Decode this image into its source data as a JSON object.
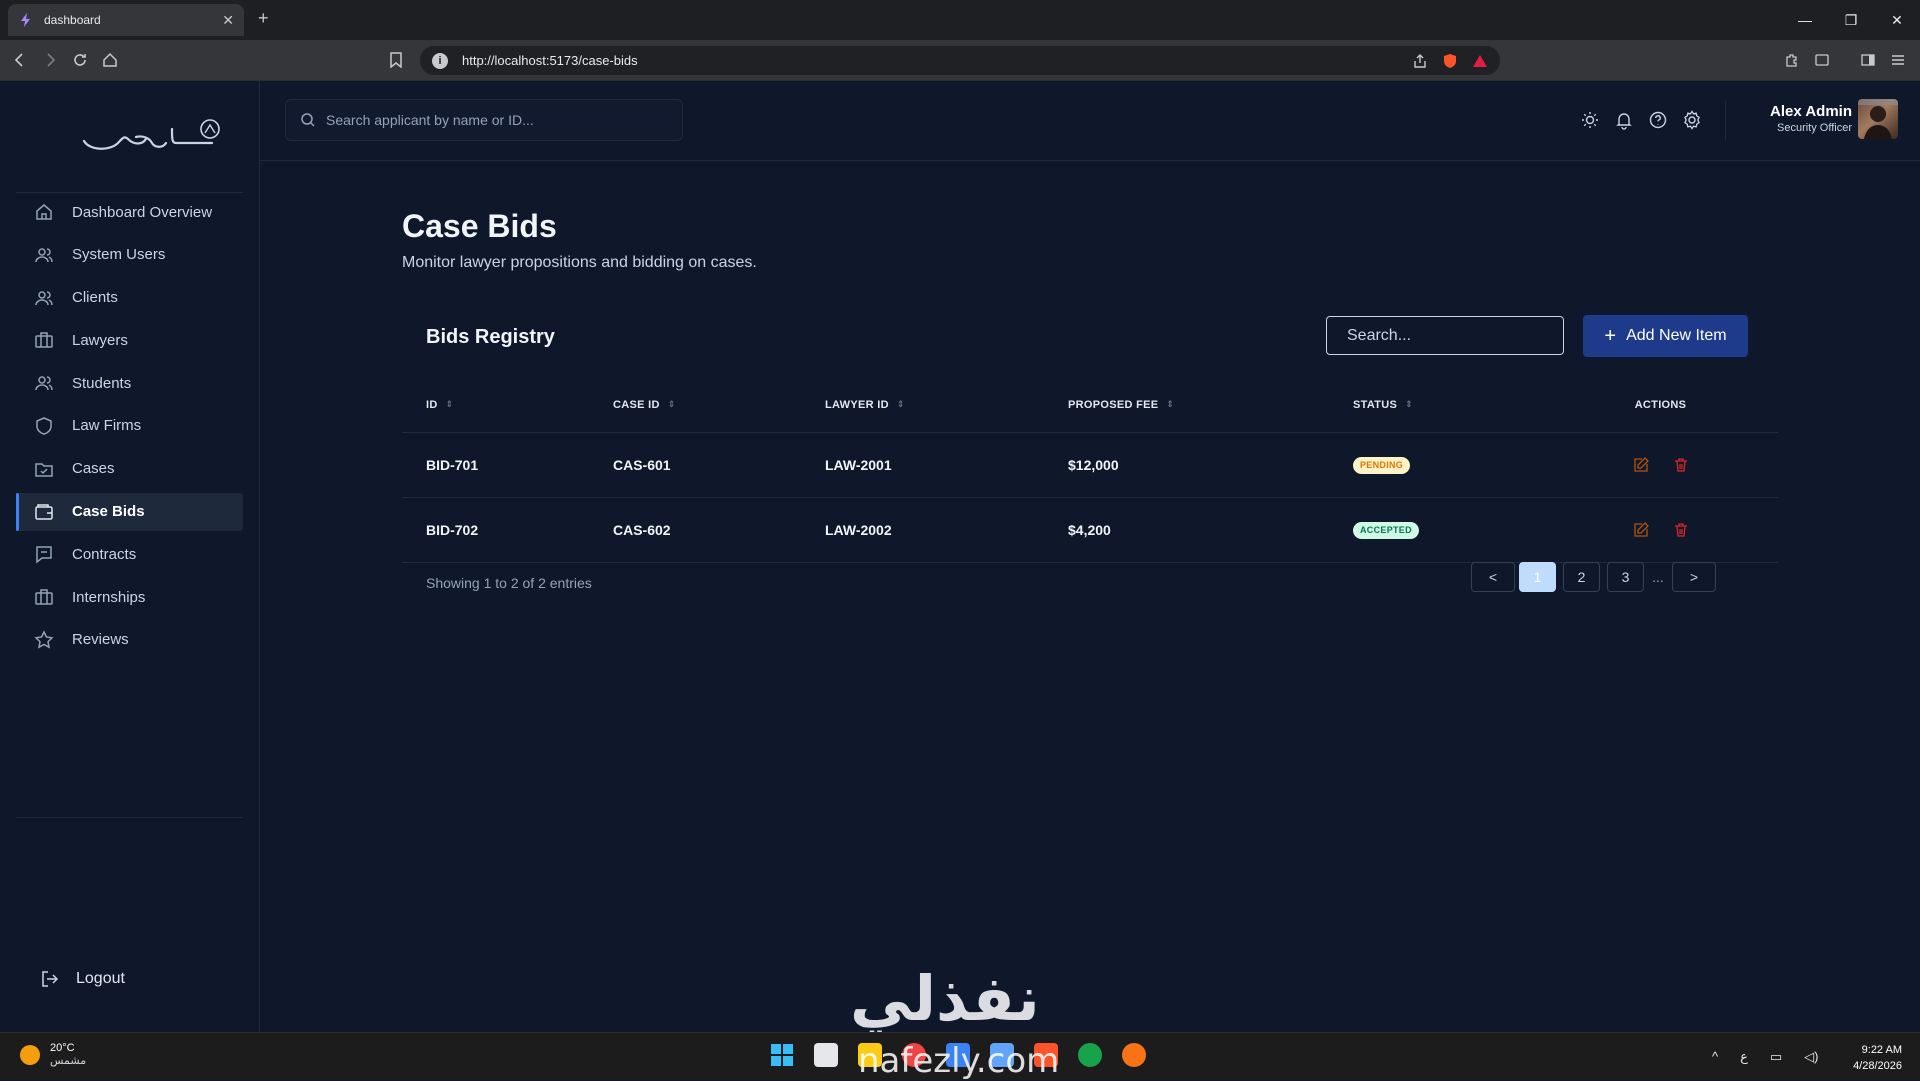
{
  "browser": {
    "tab_title": "dashboard",
    "url": "http://localhost:5173/case-bids"
  },
  "sidebar": {
    "items": [
      {
        "label": "Dashboard Overview",
        "icon": "home-icon"
      },
      {
        "label": "System Users",
        "icon": "users-icon"
      },
      {
        "label": "Clients",
        "icon": "users-icon"
      },
      {
        "label": "Lawyers",
        "icon": "briefcase-icon"
      },
      {
        "label": "Students",
        "icon": "users-icon"
      },
      {
        "label": "Law Firms",
        "icon": "shield-icon"
      },
      {
        "label": "Cases",
        "icon": "folder-icon"
      },
      {
        "label": "Case Bids",
        "icon": "wallet-icon",
        "active": true
      },
      {
        "label": "Contracts",
        "icon": "message-icon"
      },
      {
        "label": "Internships",
        "icon": "briefcase-icon"
      },
      {
        "label": "Reviews",
        "icon": "star-icon"
      }
    ],
    "logout_label": "Logout"
  },
  "header": {
    "search_placeholder": "Search applicant by name or ID...",
    "user_name": "Alex Admin",
    "user_role": "Security Officer"
  },
  "page": {
    "title": "Case Bids",
    "subtitle": "Monitor lawyer propositions and bidding on cases."
  },
  "registry": {
    "title": "Bids Registry",
    "search_placeholder": "Search...",
    "add_label": "Add New Item",
    "columns": [
      "ID",
      "CASE ID",
      "LAWYER ID",
      "PROPOSED FEE",
      "STATUS",
      "ACTIONS"
    ],
    "rows": [
      {
        "id": "BID-701",
        "case_id": "CAS-601",
        "lawyer_id": "LAW-2001",
        "fee": "$12,000",
        "status": "PENDING"
      },
      {
        "id": "BID-702",
        "case_id": "CAS-602",
        "lawyer_id": "LAW-2002",
        "fee": "$4,200",
        "status": "ACCEPTED"
      }
    ],
    "showing": "Showing 1 to 2 of 2 entries",
    "pager": {
      "prev": "<",
      "pages": [
        "1",
        "2",
        "3"
      ],
      "ellipsis": "...",
      "next": ">"
    }
  },
  "taskbar": {
    "temp": "20°C",
    "weather": "مشمس",
    "time": "9:22 AM",
    "date": "4/28/2026",
    "lang": "ع"
  },
  "watermark": {
    "arabic": "نفذلي",
    "latin": "nafezly.com"
  },
  "colors": {
    "bg": "#0f172a",
    "accent": "#1e3a8a",
    "pending": "#d97706",
    "accepted": "#047857"
  }
}
